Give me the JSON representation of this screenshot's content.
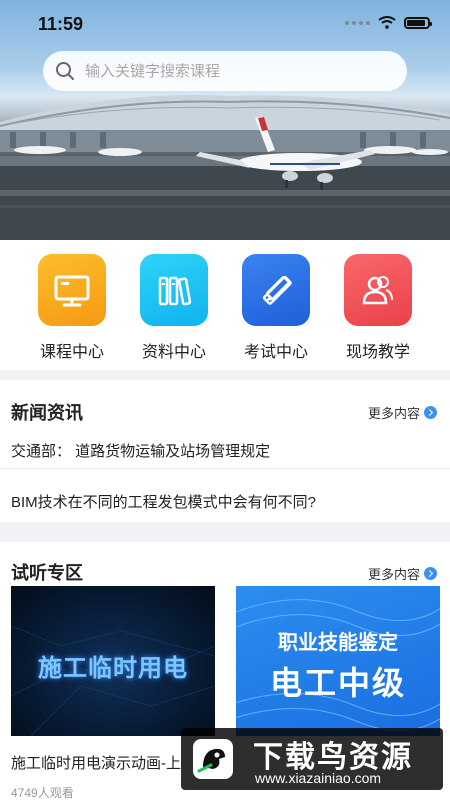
{
  "status_bar": {
    "time": "11:59"
  },
  "search": {
    "placeholder": "输入关键字搜索课程"
  },
  "categories": [
    {
      "label": "课程中心",
      "icon": "monitor-icon",
      "color": "#f8a51c"
    },
    {
      "label": "资料中心",
      "icon": "books-icon",
      "color": "#16c3f3"
    },
    {
      "label": "考试中心",
      "icon": "pencil-ruler-icon",
      "color": "#2d6fe6"
    },
    {
      "label": "现场教学",
      "icon": "users-icon",
      "color": "#f0555a"
    }
  ],
  "news": {
    "title": "新闻资讯",
    "more": "更多内容",
    "items": [
      "交通部： 道路货物运输及站场管理规定",
      "BIM技术在不同的工程发包模式中会有何不同?"
    ]
  },
  "trial": {
    "title": "试听专区",
    "more": "更多内容",
    "cards": [
      {
        "thumb_text": "施工临时用电",
        "title": "施工临时用电演示动画-上",
        "views": "4749人观看"
      },
      {
        "thumb_text_line1": "职业技能鉴定",
        "thumb_text_line2": "电工中级"
      }
    ]
  },
  "watermark": {
    "title": "下载鸟资源",
    "url": "www.xiazainiao.com"
  }
}
